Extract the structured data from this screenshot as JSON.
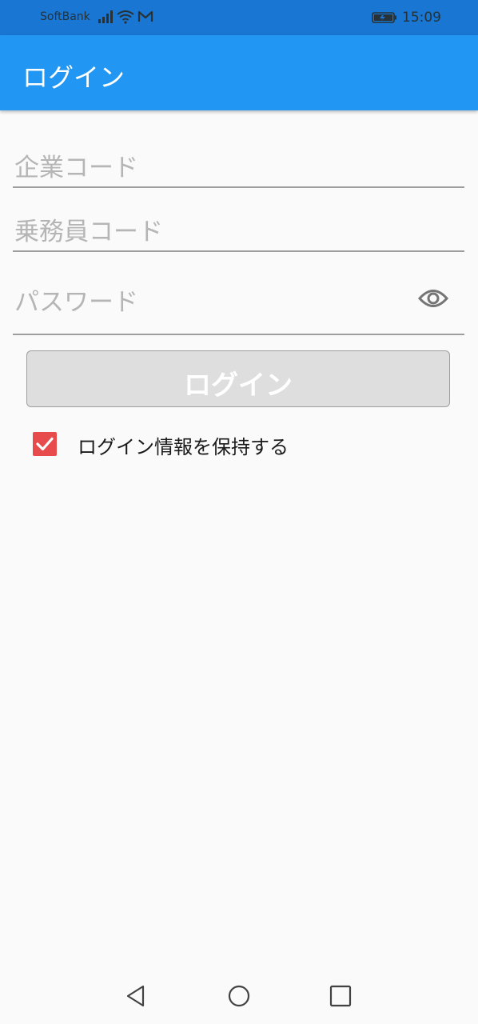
{
  "status_bar": {
    "carrier": "SoftBank",
    "time": "15:09"
  },
  "app_bar": {
    "title": "ログイン"
  },
  "form": {
    "company_code_placeholder": "企業コード",
    "crew_code_placeholder": "乗務員コード",
    "password_placeholder": "パスワード"
  },
  "login_button": {
    "label": "ログイン"
  },
  "remember": {
    "label": "ログイン情報を保持する",
    "checked": true
  },
  "colors": {
    "status_bar": "#1976d2",
    "app_bar": "#2196f3",
    "checkbox": "#e84b4b"
  },
  "icons": [
    "signal-icon",
    "wifi-icon",
    "mail-icon",
    "battery-icon",
    "eye-icon",
    "check-icon",
    "back-icon",
    "home-icon",
    "recents-icon"
  ]
}
